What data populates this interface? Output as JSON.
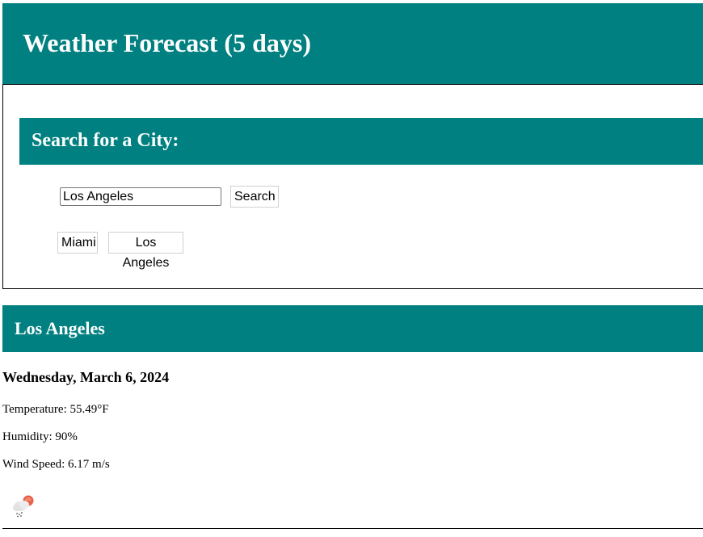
{
  "header": {
    "title": "Weather Forecast (5 days)"
  },
  "search": {
    "heading": "Search for a City:",
    "input_value": "Los Angeles",
    "button_label": "Search",
    "history": [
      "Miami",
      "Los Angeles"
    ]
  },
  "current": {
    "city": "Los Angeles",
    "date": "Wednesday, March 6, 2024",
    "temperature": "Temperature: 55.49°F",
    "humidity": "Humidity: 90%",
    "wind": "Wind Speed: 6.17 m/s",
    "icon": "cloud-rain-sun-icon"
  },
  "colors": {
    "accent": "#008080"
  }
}
